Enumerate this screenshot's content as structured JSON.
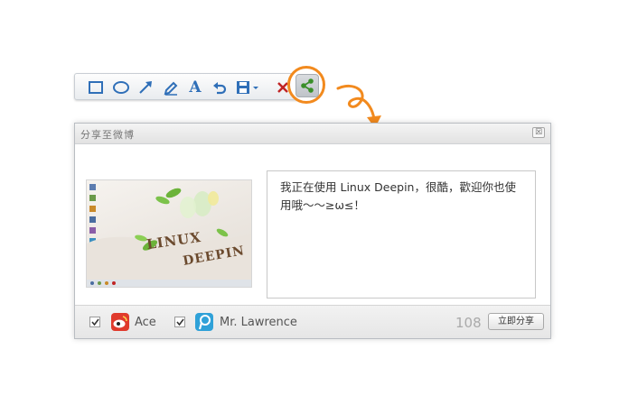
{
  "toolbar": {
    "tools": [
      {
        "icon": "rectangle-icon"
      },
      {
        "icon": "ellipse-icon"
      },
      {
        "icon": "arrow-icon"
      },
      {
        "icon": "pencil-icon"
      },
      {
        "icon": "text-icon",
        "glyph": "A"
      },
      {
        "icon": "undo-icon"
      },
      {
        "icon": "save-icon"
      },
      {
        "icon": "close-icon"
      },
      {
        "icon": "share-icon"
      }
    ],
    "accent_color": "#2f6fb8",
    "highlight_color": "#f28a1e"
  },
  "dialog": {
    "title": "分享至微博",
    "close_glyph": "☒",
    "message": "我正在使用 Linux Deepin，很酷，歡迎你也使用哦～～≥ω≤！",
    "thumbnail_words": [
      "LINUX",
      "DEEPIN"
    ],
    "accounts": [
      {
        "name": "Ace",
        "checked": true,
        "icon": "weibo-icon",
        "color": "#e03a2c"
      },
      {
        "name": "Mr. Lawrence",
        "checked": true,
        "icon": "tencent-weibo-icon",
        "color": "#2fa1d8"
      }
    ],
    "char_count": "108",
    "share_button": "立即分享"
  }
}
